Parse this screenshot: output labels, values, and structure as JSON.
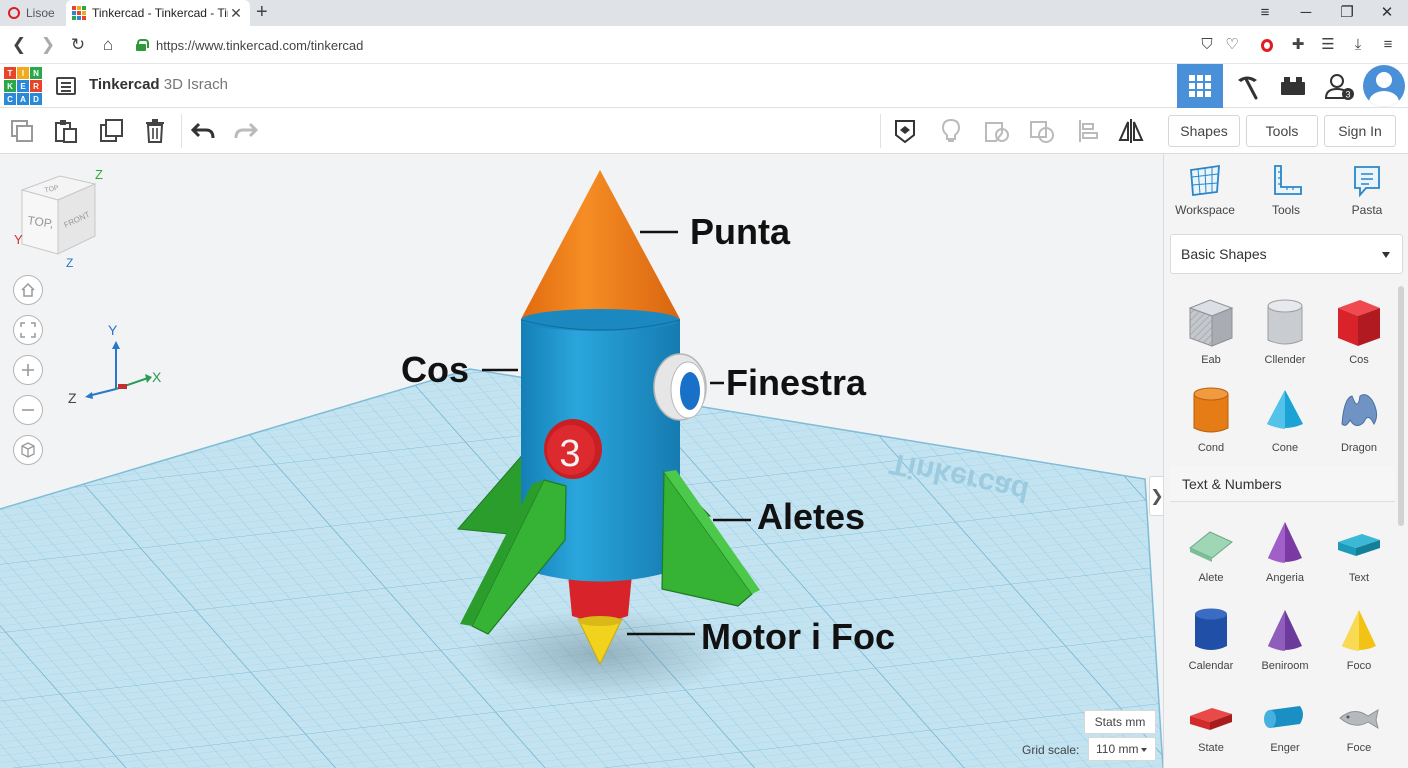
{
  "browser": {
    "tabs": [
      {
        "title": "Lisoe"
      },
      {
        "title": "Tinkercad - Tinkercad - Tinkercad"
      }
    ],
    "url": "https://www.tinkercad.com/tinkercad"
  },
  "header": {
    "logo_letters": [
      "T",
      "I",
      "N",
      "K",
      "E",
      "R",
      "C",
      "A",
      "D"
    ],
    "title_brand": "Tinkercad",
    "title_name": "3D Israch",
    "notification_count": "3"
  },
  "toolbar": {
    "shapes_label": "Shapes",
    "tools_label": "Tools",
    "signin_label": "Sign In"
  },
  "viewcube": {
    "top": "TOP",
    "face_top": "TOP,",
    "face_front": "FRONT",
    "z": "Z",
    "y": "Y"
  },
  "axes": {
    "x": "X",
    "y": "Y",
    "z": "Z"
  },
  "workplane": {
    "watermark": "Tinkercad",
    "rocket_number": "3",
    "labels": {
      "punta": "Punta",
      "cos": "Cos",
      "finestra": "Finestra",
      "aletes": "Aletes",
      "motor": "Motor i Foc"
    },
    "stats_label": "Stats mm",
    "grid_scale_label": "Grid scale:",
    "grid_scale_value": "110 mm"
  },
  "panel": {
    "tabs": [
      {
        "label": "Workspace",
        "icon": "workplane-icon"
      },
      {
        "label": "Tools",
        "icon": "ruler-icon"
      },
      {
        "label": "Pasta",
        "icon": "note-icon"
      }
    ],
    "dropdown_value": "Basic Shapes",
    "section_title": "Text & Numbers",
    "basic_shapes": [
      {
        "label": "Eab",
        "color": "#b8bcc2"
      },
      {
        "label": "Cllender",
        "color": "#c9ccd0"
      },
      {
        "label": "Cos",
        "color": "#d8232a"
      },
      {
        "label": "Cond",
        "color": "#e57c16"
      },
      {
        "label": "Cone",
        "color": "#1aa3d4"
      },
      {
        "label": "Dragon",
        "color": "#6f94c4"
      }
    ],
    "text_shapes": [
      {
        "label": "Alete",
        "color": "#8fcfa8"
      },
      {
        "label": "Angeria",
        "color": "#7a3aa3"
      },
      {
        "label": "Text",
        "color": "#1b9ab9"
      },
      {
        "label": "Calendar",
        "color": "#1f4fa6"
      },
      {
        "label": "Beniroom",
        "color": "#6b3a9a"
      },
      {
        "label": "Foco",
        "color": "#f2c214"
      },
      {
        "label": "State",
        "color": "#d12a2a"
      },
      {
        "label": "Enger",
        "color": "#1a8fc4"
      },
      {
        "label": "Foce",
        "color": "#b5b8bc"
      }
    ]
  },
  "colors": {
    "accent": "#4a90d9",
    "grid": "#aed7ea",
    "rocket_body": "#1e93cc",
    "rocket_nose": "#f07e17",
    "rocket_fins": "#36b334",
    "rocket_engine": "#d8232a",
    "rocket_flame": "#f1d21c"
  }
}
